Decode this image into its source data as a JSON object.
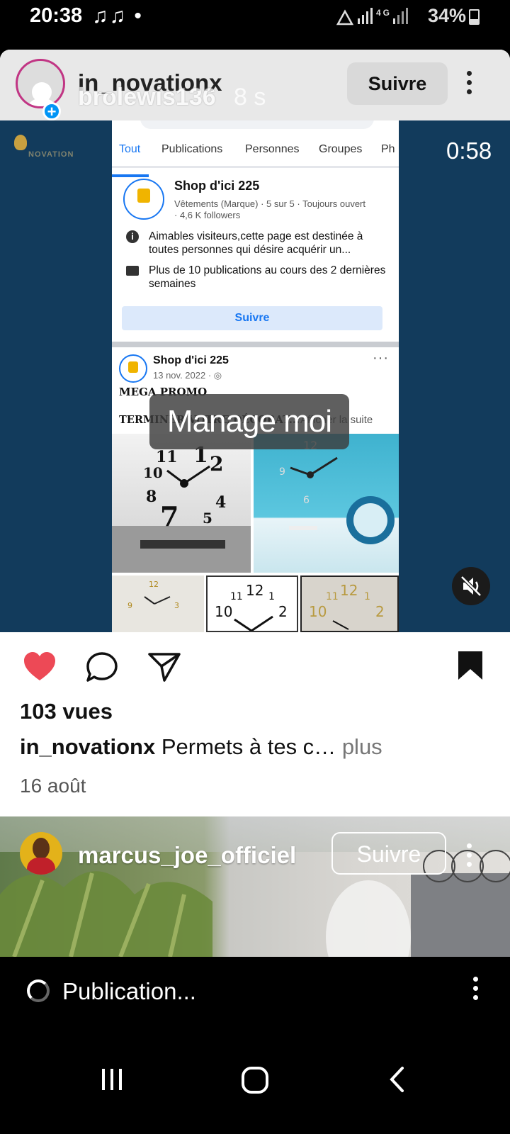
{
  "status_bar": {
    "time": "20:38",
    "notification_icons": "♫♫ •",
    "battery": "34%",
    "network_label": "4G"
  },
  "post": {
    "username": "in_novationx",
    "overlay_username": "brolewis136",
    "overlay_time": "8 s",
    "follow_label": "Suivre",
    "video": {
      "duration": "0:58",
      "logo_text": "NOVATION",
      "caption_overlay": "Manage moi",
      "screenshot": {
        "tabs": [
          "Tout",
          "Publications",
          "Personnes",
          "Groupes",
          "Ph"
        ],
        "active_tab": "Tout",
        "page_name": "Shop d'ici 225",
        "page_meta_line1": "Vêtements (Marque) · 5 sur 5 · Toujours ouvert",
        "page_meta_line2": "· 4,6 K followers",
        "info_line1": "Aimables visiteurs,cette page est destinée à toutes personnes qui désire acquérir un...",
        "info_line2": "Plus de 10 publications au cours des 2 dernières semaines",
        "follow_button": "Suivre",
        "post_author": "Shop d'ici 225",
        "post_date": "13 nov. 2022 · ◎",
        "post_more": "···",
        "mega_promo": "MEGA PROMO",
        "post_text": "TERMINER VOTRE DÉCORAT...",
        "see_more": "Afficher la suite"
      }
    },
    "views": "103 vues",
    "caption_user": "in_novationx",
    "caption_text": "Permets à tes c…",
    "caption_more": "plus",
    "date": "16 août"
  },
  "next_post": {
    "username": "marcus_joe_officiel",
    "follow_label": "Suivre"
  },
  "publishing": {
    "label": "Publication..."
  },
  "colors": {
    "like_red": "#ed4956",
    "facebook_blue": "#1877f2",
    "video_bg": "#123b5c"
  }
}
